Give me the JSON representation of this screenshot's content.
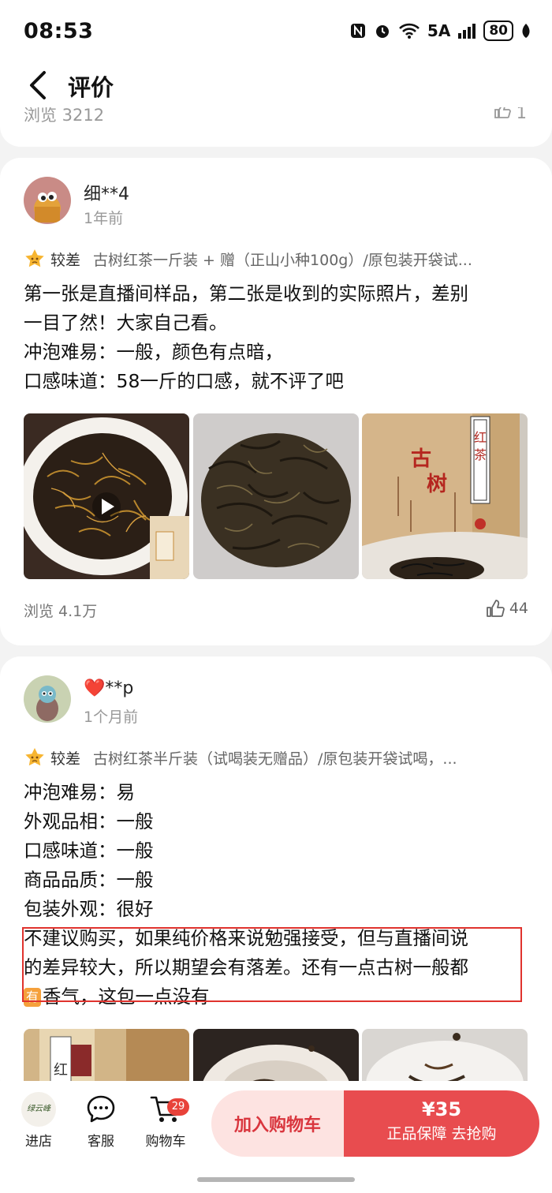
{
  "status_bar": {
    "time": "08:53",
    "network": "5A",
    "battery": "80"
  },
  "nav": {
    "title": "评价"
  },
  "previous_card": {
    "views_partial": "浏览 3212",
    "likes_partial": "1"
  },
  "reviews": [
    {
      "user": "细**4",
      "time": "1年前",
      "rating": "较差",
      "variant": "古树红茶一斤装 + 赠（正山小种100g）/原包装开袋试...",
      "lines": [
        "第一张是直播间样品，第二张是收到的实际照片，差别",
        "一目了然！大家自己看。",
        "冲泡难易：一般，颜色有点暗，",
        "口感味道：58一斤的口感，就不评了吧"
      ],
      "photo_text": {
        "bag_label_1": "红",
        "bag_label_2": "茶",
        "bag_brand_1": "古",
        "bag_brand_2": "树"
      },
      "views": "浏览 4.1万",
      "likes": "44"
    },
    {
      "user": "❤️**p",
      "time": "1个月前",
      "rating": "较差",
      "variant": "古树红茶半斤装（试喝装无赠品）/原包装开袋试喝，...",
      "lines": [
        "冲泡难易：易",
        "外观品相：一般",
        "口感味道：一般",
        "商品品质：一般",
        "包装外观：很好"
      ],
      "highlight_lines": [
        "不建议购买，如果纯价格来说勉强接受，但与直播间说",
        "的差异较大，所以期望会有落差。还有一点古树一般都"
      ],
      "highlight_tag": "有",
      "highlight_tail": "香气，这包一点没有",
      "photo_text": {
        "bag_label": "红"
      }
    }
  ],
  "bottom_bar": {
    "store_logo": "绿云峰",
    "store_label": "进店",
    "service_label": "客服",
    "cart_label": "购物车",
    "cart_count": "29",
    "add_to_cart": "加入购物车",
    "price": "¥35",
    "buy_sub": "正品保障 去抢购"
  },
  "colors": {
    "accent": "#e84c4f",
    "accent_light": "#fde3e1",
    "highlight_border": "#e0332e",
    "tag": "#f5a03b"
  }
}
